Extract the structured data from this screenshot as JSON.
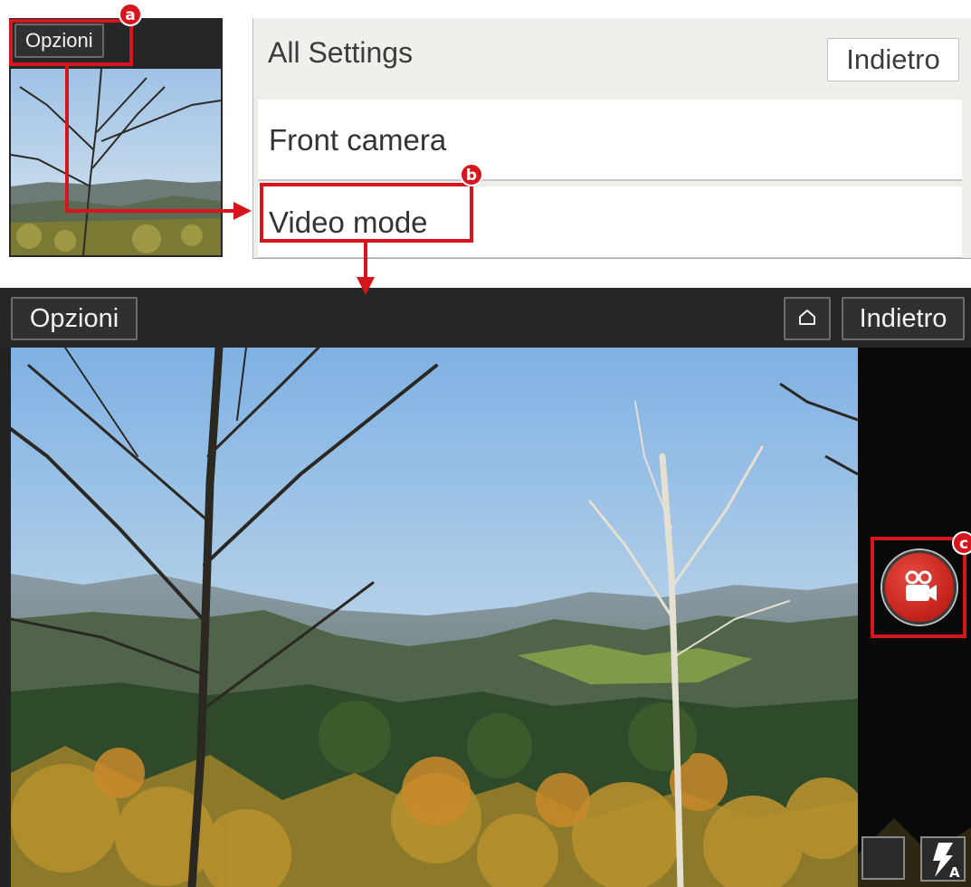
{
  "thumbnail": {
    "options_label": "Opzioni"
  },
  "settings": {
    "title": "All Settings",
    "back_label": "Indietro",
    "items": [
      {
        "label": "Front camera"
      },
      {
        "label": "Video mode"
      }
    ]
  },
  "camera": {
    "options_label": "Opzioni",
    "home_icon": "home-icon",
    "back_label": "Indietro",
    "record_icon": "video-camera-icon",
    "record_color": "#d22a22",
    "flash_icon": "flash-auto-icon",
    "flash_mode": "A"
  },
  "annotations": {
    "accent_color": "#d7151d",
    "labels": [
      "a",
      "b",
      "c"
    ]
  }
}
